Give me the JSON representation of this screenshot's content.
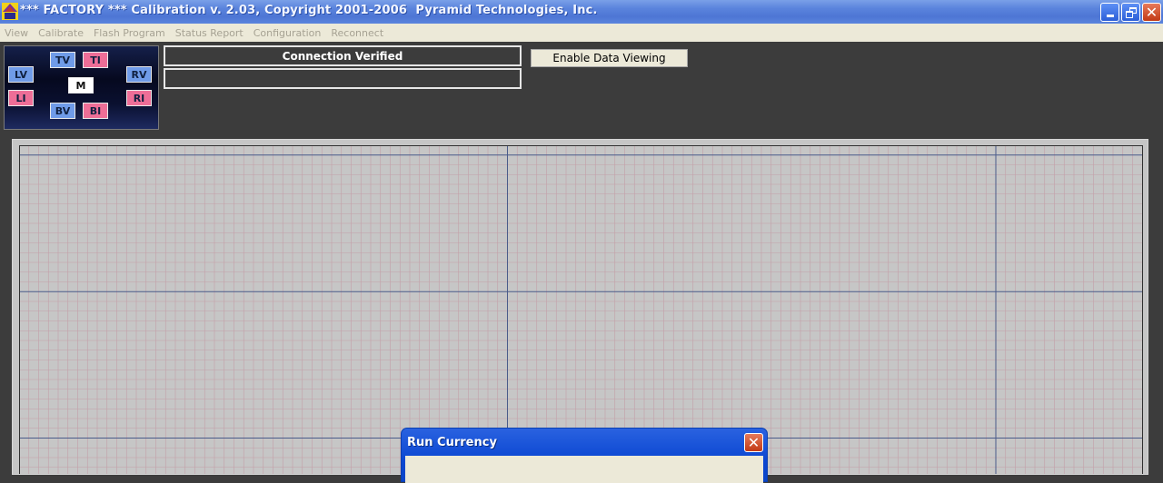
{
  "window": {
    "title": "*** FACTORY *** Calibration v. 2.03, Copyright 2001-2006  Pyramid Technologies, Inc.",
    "close_glyph": "✕"
  },
  "menu": [
    "View",
    "Calibrate",
    "Flash Program",
    "Status Report",
    "Configuration",
    "Reconnect"
  ],
  "panel_map": {
    "buttons": {
      "tv": "TV",
      "ti": "TI",
      "lv": "LV",
      "rv": "RV",
      "li": "LI",
      "ri": "RI",
      "m": "M",
      "bv": "BV",
      "bi": "BI"
    },
    "colors": {
      "voltage": "#6f9be8",
      "current": "#ee6e97",
      "main": "#ffffff"
    }
  },
  "status": {
    "line1": "Connection Verified",
    "line2": ""
  },
  "toolbar": {
    "enable_data_viewing": "Enable Data Viewing"
  },
  "dialog": {
    "title": "Run Currency",
    "close_glyph": "✕"
  },
  "colors": {
    "titlebar": "#4d76d4",
    "chart_background": "#c6c6c6",
    "chart_minor_grid": "#c39fa8",
    "chart_major_grid": "#4a5b8a"
  }
}
